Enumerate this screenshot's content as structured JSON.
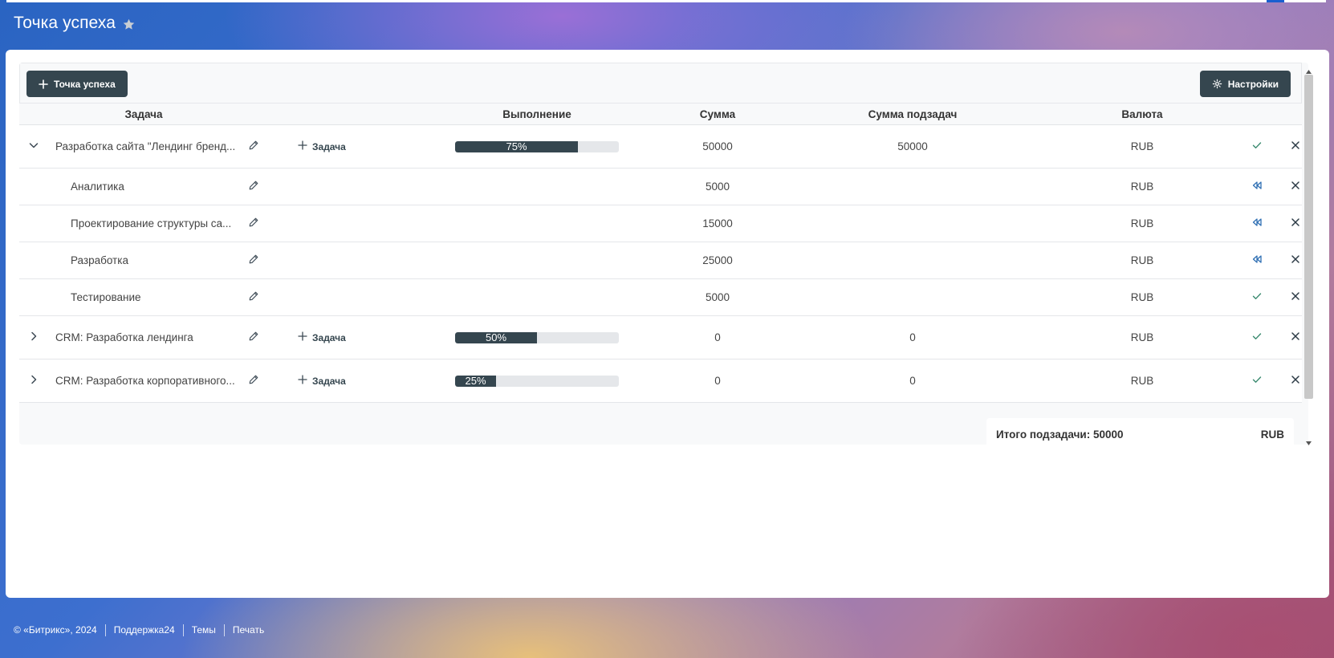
{
  "page": {
    "title": "Точка успеха"
  },
  "toolbar": {
    "add_label": "Точка успеха",
    "settings_label": "Настройки"
  },
  "columns": {
    "task": "Задача",
    "progress": "Выполнение",
    "sum": "Сумма",
    "subsum": "Сумма подзадач",
    "currency": "Валюта"
  },
  "rows": [
    {
      "name": "Разработка сайта \"Лендинг бренд...",
      "add_task": "Задача",
      "progress": 0.75,
      "progress_label": "75%",
      "sum": "50000",
      "subsum": "50000",
      "currency": "RUB"
    },
    {
      "name": "Аналитика",
      "sum": "5000",
      "currency": "RUB"
    },
    {
      "name": "Проектирование структуры са...",
      "sum": "15000",
      "currency": "RUB"
    },
    {
      "name": "Разработка",
      "sum": "25000",
      "currency": "RUB"
    },
    {
      "name": "Тестирование",
      "sum": "5000",
      "currency": "RUB"
    },
    {
      "name": "CRM: Разработка лендинга",
      "add_task": "Задача",
      "progress": 0.5,
      "progress_label": "50%",
      "sum": "0",
      "subsum": "0",
      "currency": "RUB"
    },
    {
      "name": "CRM: Разработка корпоративного...",
      "add_task": "Задача",
      "progress": 0.25,
      "progress_label": "25%",
      "sum": "0",
      "subsum": "0",
      "currency": "RUB"
    }
  ],
  "totals": {
    "label": "Итого подзадачи: 50000",
    "currency": "RUB"
  },
  "footer": {
    "copyright": "© «Битрикс», 2024",
    "support": "Поддержка24",
    "themes": "Темы",
    "print": "Печать"
  },
  "colors": {
    "accent_dark": "#35464f",
    "bar_track": "#e5e7ea",
    "icon_blue": "#2f6fb3"
  },
  "icons": {
    "title_star": "star-icon",
    "add": "plus-icon",
    "settings": "gear-icon",
    "expand": "chevron-right-icon",
    "collapse": "chevron-down-icon",
    "edit": "pencil-icon",
    "confirm": "check-icon",
    "rewind": "rewind-icon",
    "delete": "close-icon"
  }
}
